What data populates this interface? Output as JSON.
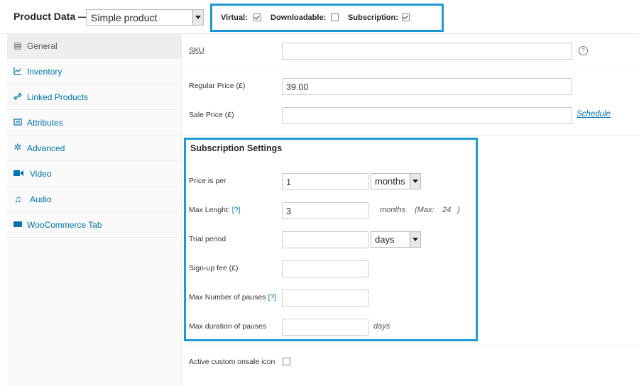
{
  "header": {
    "title": "Product Data —",
    "product_type": "Simple product",
    "options": [
      {
        "label": "Virtual:",
        "checked": true
      },
      {
        "label": "Downloadable:",
        "checked": false
      },
      {
        "label": "Subscription:",
        "checked": true
      }
    ]
  },
  "sidebar": {
    "items": [
      {
        "label": "General",
        "icon": "general-icon",
        "active": true
      },
      {
        "label": "Inventory",
        "icon": "inventory-icon"
      },
      {
        "label": "Linked Products",
        "icon": "link-icon"
      },
      {
        "label": "Attributes",
        "icon": "attributes-icon"
      },
      {
        "label": "Advanced",
        "icon": "gear-icon"
      },
      {
        "label": "Video",
        "icon": "video-icon"
      },
      {
        "label": "Audio",
        "icon": "audio-icon"
      },
      {
        "label": "WooCommerce Tab",
        "icon": "tab-icon"
      }
    ]
  },
  "general": {
    "sku_label": "SKU",
    "sku_value": "",
    "help_icon": "?",
    "regular_price_label": "Regular Price (£)",
    "regular_price_value": "39.00",
    "sale_price_label": "Sale Price (£)",
    "sale_price_value": "",
    "schedule_link": "Schedule"
  },
  "subscription": {
    "title": "Subscription Settings",
    "price_per_label": "Price is per",
    "price_per_value": "1",
    "price_per_unit": "months",
    "max_length_label": "Max Lenght:",
    "help_marker": "[?]",
    "max_length_value": "3",
    "max_length_unit": "months",
    "max_note_prefix": "(Max:",
    "max_note_value": "24",
    "max_note_suffix": ")",
    "trial_label": "Trial period",
    "trial_value": "",
    "trial_unit": "days",
    "signup_label": "Sign-up fee (£)",
    "signup_value": "",
    "pauses_label": "Max Number of pauses",
    "pauses_value": "",
    "pause_duration_label": "Max duration of pauses",
    "pause_duration_value": "",
    "pause_duration_unit": "days"
  },
  "onsale": {
    "label": "Active custom onsale icon",
    "checked": false
  },
  "colors": {
    "highlight": "#1d9ad6",
    "link": "#0073aa"
  }
}
